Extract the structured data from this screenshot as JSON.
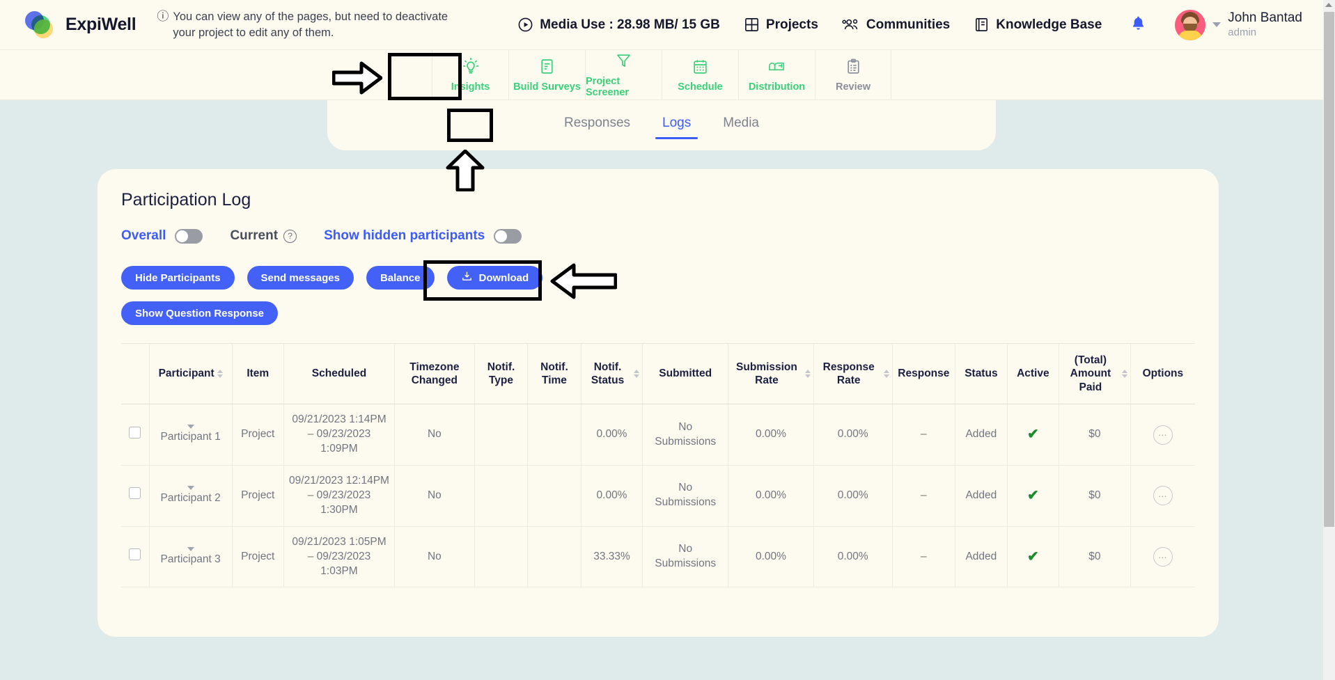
{
  "brand": {
    "name": "ExpiWell",
    "logo_icon": "expiwell-logo-icon"
  },
  "notice": {
    "icon": "info-circle-icon",
    "text": "You can view any of the pages, but need to deactivate your project to edit any of them."
  },
  "topnav": {
    "media_use": {
      "icon": "play-circle-icon",
      "label": "Media Use : 28.98 MB/ 15 GB"
    },
    "projects": {
      "icon": "grid-icon",
      "label": "Projects"
    },
    "communities": {
      "icon": "people-icon",
      "label": "Communities"
    },
    "knowledge_base": {
      "icon": "book-icon",
      "label": "Knowledge Base"
    },
    "notifications": {
      "icon": "bell-icon"
    },
    "user": {
      "avatar_icon": "user-avatar",
      "caret_icon": "chevron-down-icon",
      "name": "John Bantad",
      "role": "admin"
    }
  },
  "section_nav": {
    "items": [
      {
        "label": "Insights",
        "icon": "lightbulb-icon",
        "state": "active"
      },
      {
        "label": "Build Surveys",
        "icon": "document-icon",
        "state": "enabled"
      },
      {
        "label": "Project Screener",
        "icon": "funnel-icon",
        "state": "enabled"
      },
      {
        "label": "Schedule",
        "icon": "calendar-icon",
        "state": "enabled"
      },
      {
        "label": "Distribution",
        "icon": "mailbox-icon",
        "state": "enabled"
      },
      {
        "label": "Review",
        "icon": "clipboard-icon",
        "state": "disabled"
      }
    ]
  },
  "sub_tabs": {
    "items": [
      {
        "label": "Responses",
        "active": false
      },
      {
        "label": "Logs",
        "active": true
      },
      {
        "label": "Media",
        "active": false
      }
    ]
  },
  "panel": {
    "title": "Participation Log",
    "toggles": [
      {
        "label": "Overall",
        "state": "off",
        "accent": "#3b5bfd"
      },
      {
        "label": "Current",
        "help_icon": "question-circle-icon"
      },
      {
        "label": "Show hidden participants",
        "state": "off",
        "accent": "#3b5bfd"
      }
    ],
    "buttons": [
      {
        "label": "Hide Participants",
        "icon": null
      },
      {
        "label": "Send messages",
        "icon": null
      },
      {
        "label": "Balance",
        "icon": null
      },
      {
        "label": "Download",
        "icon": "download-icon",
        "highlighted": true
      },
      {
        "label": "Show Question Response",
        "icon": null
      }
    ]
  },
  "table": {
    "columns": [
      {
        "label": "",
        "sortable": false
      },
      {
        "label": "Participant",
        "sortable": true
      },
      {
        "label": "Item",
        "sortable": false
      },
      {
        "label": "Scheduled",
        "sortable": false
      },
      {
        "label": "Timezone Changed",
        "sortable": false
      },
      {
        "label": "Notif. Type",
        "sortable": false
      },
      {
        "label": "Notif. Time",
        "sortable": false
      },
      {
        "label": "Notif. Status",
        "sortable": true
      },
      {
        "label": "Submitted",
        "sortable": false
      },
      {
        "label": "Submission Rate",
        "sortable": true
      },
      {
        "label": "Response Rate",
        "sortable": true
      },
      {
        "label": "Response",
        "sortable": false
      },
      {
        "label": "Status",
        "sortable": false
      },
      {
        "label": "Active",
        "sortable": false
      },
      {
        "label": "(Total) Amount Paid",
        "sortable": true
      },
      {
        "label": "Options",
        "sortable": false
      }
    ],
    "rows": [
      {
        "participant": "Participant 1",
        "item": "Project",
        "scheduled": "09/21/2023 1:14PM – 09/23/2023 1:09PM",
        "timezone_changed": "No",
        "notif_type": "",
        "notif_time": "",
        "notif_status": "0.00%",
        "submitted": "No Submissions",
        "submission_rate": "0.00%",
        "response_rate": "0.00%",
        "response": "–",
        "status": "Added",
        "active": "✔",
        "amount_paid": "$0",
        "options": "…"
      },
      {
        "participant": "Participant 2",
        "item": "Project",
        "scheduled": "09/21/2023 12:14PM – 09/23/2023 1:30PM",
        "timezone_changed": "No",
        "notif_type": "",
        "notif_time": "",
        "notif_status": "0.00%",
        "submitted": "No Submissions",
        "submission_rate": "0.00%",
        "response_rate": "0.00%",
        "response": "–",
        "status": "Added",
        "active": "✔",
        "amount_paid": "$0",
        "options": "…"
      },
      {
        "participant": "Participant 3",
        "item": "Project",
        "scheduled": "09/21/2023 1:05PM – 09/23/2023 1:03PM",
        "timezone_changed": "No",
        "notif_type": "",
        "notif_time": "",
        "notif_status": "33.33%",
        "submitted": "No Submissions",
        "submission_rate": "0.00%",
        "response_rate": "0.00%",
        "response": "–",
        "status": "Added",
        "active": "✔",
        "amount_paid": "$0",
        "options": "…"
      }
    ]
  },
  "annotations": {
    "highlights": [
      "insights-tab",
      "logs-subtab",
      "download-button"
    ],
    "arrows": [
      "arrow-to-insights",
      "arrow-to-logs",
      "arrow-to-download"
    ]
  },
  "colors": {
    "page_background": "#dfeaea",
    "card_background": "#fdfaf0",
    "primary_button": "#4361f7",
    "nav_green": "#3ad07a",
    "active_blue": "#3b5bfd",
    "check_green": "#1d8b2e"
  }
}
